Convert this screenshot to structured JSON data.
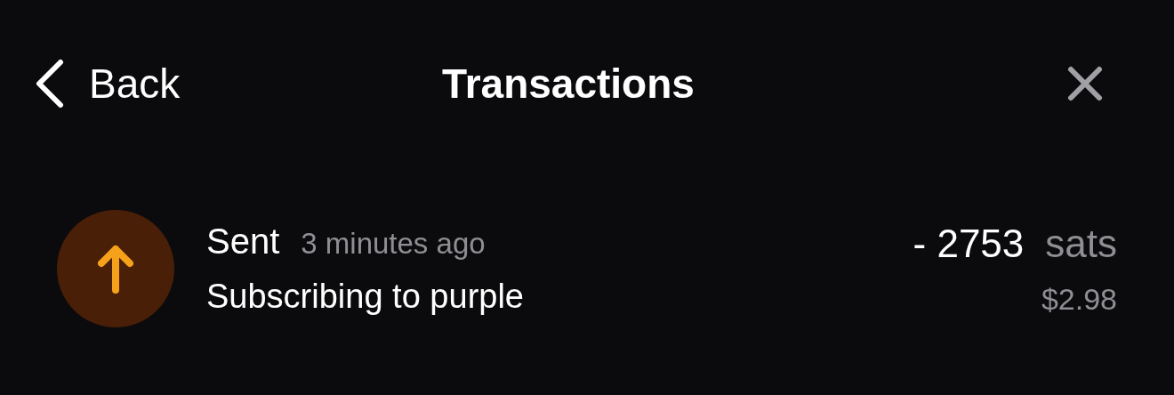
{
  "header": {
    "back_label": "Back",
    "title": "Transactions"
  },
  "transactions": [
    {
      "kind": "sent",
      "label": "Sent",
      "time": "3 minutes ago",
      "memo": "Subscribing to purple",
      "amount": "- 2753",
      "unit": "sats",
      "fiat": "$2.98"
    }
  ]
}
